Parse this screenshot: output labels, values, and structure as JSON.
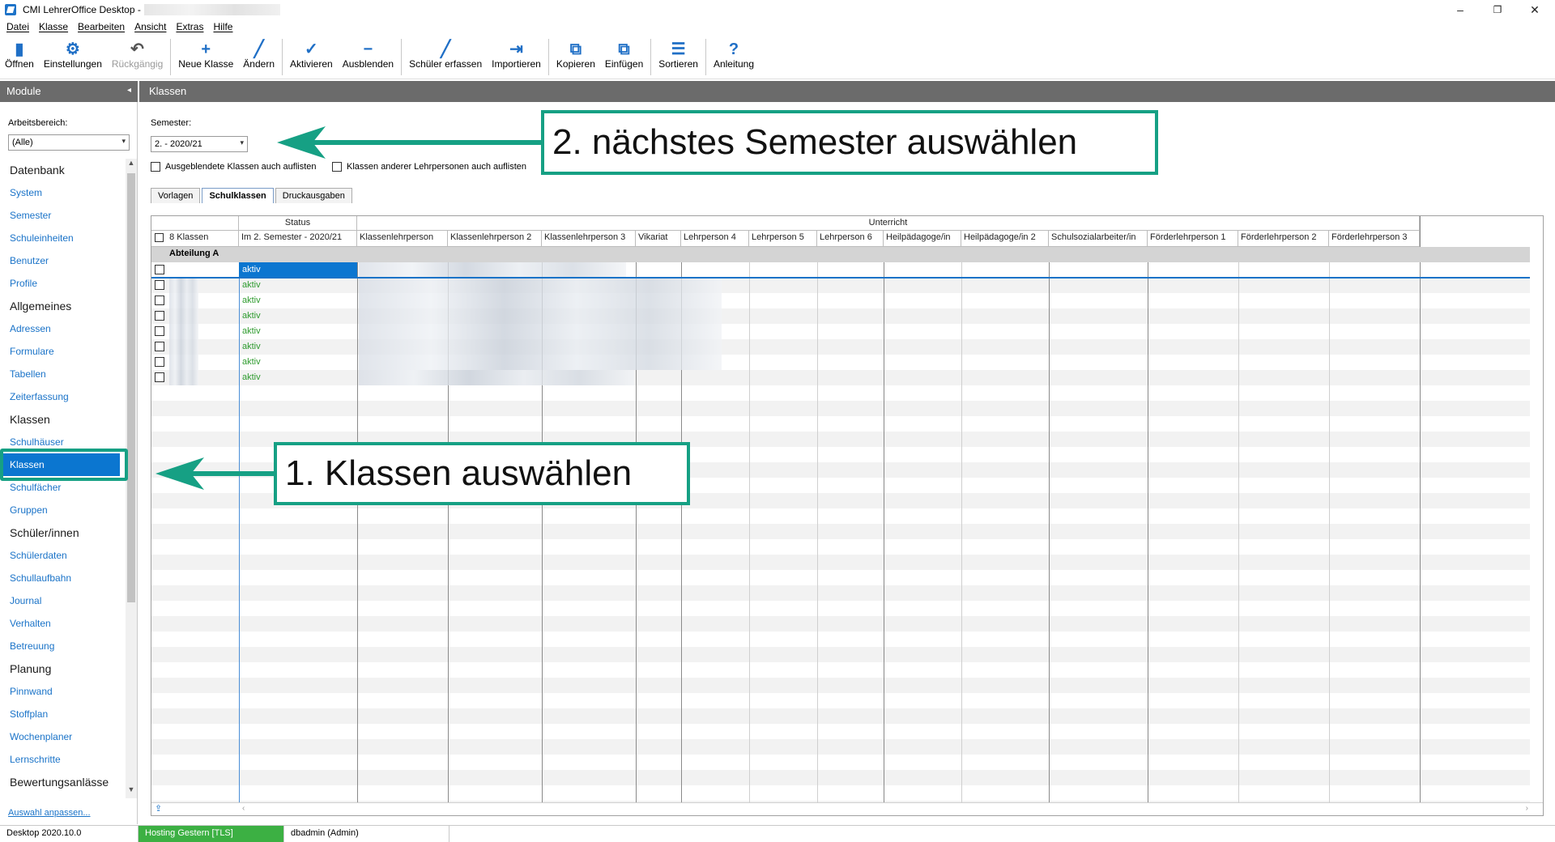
{
  "window": {
    "title": "CMI LehrerOffice Desktop -",
    "minimize_glyph": "–",
    "restore_glyph": "❐",
    "close_glyph": "✕"
  },
  "menu": [
    "Datei",
    "Klasse",
    "Bearbeiten",
    "Ansicht",
    "Extras",
    "Hilfe"
  ],
  "toolbar": {
    "buttons": [
      {
        "label": "Öffnen",
        "icon": "open-book-icon",
        "glyph": "▮"
      },
      {
        "label": "Einstellungen",
        "icon": "gear-icon",
        "glyph": "⚙"
      },
      {
        "label": "Rückgängig",
        "icon": "undo-icon",
        "glyph": "↶",
        "disabled": true
      },
      {
        "label": "Neue Klasse",
        "icon": "plus-icon",
        "glyph": "+"
      },
      {
        "label": "Ändern",
        "icon": "pencil-icon",
        "glyph": "╱"
      },
      {
        "label": "Aktivieren",
        "icon": "check-icon",
        "glyph": "✓"
      },
      {
        "label": "Ausblenden",
        "icon": "minus-icon",
        "glyph": "−"
      },
      {
        "label": "Schüler erfassen",
        "icon": "pencil-icon",
        "glyph": "╱"
      },
      {
        "label": "Importieren",
        "icon": "import-icon",
        "glyph": "⇥"
      },
      {
        "label": "Kopieren",
        "icon": "copy-icon",
        "glyph": "⧉"
      },
      {
        "label": "Einfügen",
        "icon": "paste-icon",
        "glyph": "⧉"
      },
      {
        "label": "Sortieren",
        "icon": "sort-icon",
        "glyph": "☰"
      },
      {
        "label": "Anleitung",
        "icon": "help-icon",
        "glyph": "?"
      }
    ]
  },
  "sidebar": {
    "header": "Module",
    "collapse_glyph": "◂",
    "workspace_label": "Arbeitsbereich:",
    "workspace_value": "(Alle)",
    "groups": [
      {
        "title": "Datenbank",
        "items": [
          "System",
          "Semester",
          "Schuleinheiten",
          "Benutzer",
          "Profile"
        ]
      },
      {
        "title": "Allgemeines",
        "items": [
          "Adressen",
          "Formulare",
          "Tabellen",
          "Zeiterfassung"
        ]
      },
      {
        "title": "Klassen",
        "items": [
          "Schulhäuser",
          "Klassen",
          "Schulfächer",
          "Gruppen"
        ]
      },
      {
        "title": "Schüler/innen",
        "items": [
          "Schülerdaten",
          "Schullaufbahn",
          "Journal",
          "Verhalten",
          "Betreuung"
        ]
      },
      {
        "title": "Planung",
        "items": [
          "Pinnwand",
          "Stoffplan",
          "Wochenplaner",
          "Lernschritte"
        ]
      },
      {
        "title": "Bewertungsanlässe",
        "items": []
      }
    ],
    "selected_item": "Klassen",
    "adjust_link": "Auswahl anpassen..."
  },
  "main": {
    "header": "Klassen",
    "semester_label": "Semester:",
    "semester_value": "2. - 2020/21",
    "option_hidden": "Ausgeblendete Klassen auch auflisten",
    "option_other_teachers": "Klassen anderer Lehrpersonen auch auflisten",
    "tabs": [
      "Vorlagen",
      "Schulklassen",
      "Druckausgaben"
    ],
    "active_tab": "Schulklassen"
  },
  "grid": {
    "group_header_status": "Status",
    "group_header_unterricht": "Unterricht",
    "count_label": "8 Klassen",
    "columns": [
      "Im 2. Semester - 2020/21",
      "Klassenlehrperson",
      "Klassenlehrperson 2",
      "Klassenlehrperson 3",
      "Vikariat",
      "Lehrperson 4",
      "Lehrperson 5",
      "Lehrperson 6",
      "Heilpädagoge/in",
      "Heilpädagoge/in 2",
      "Schulsozialarbeiter/in",
      "Förderlehrperson 1",
      "Förderlehrperson 2",
      "Förderlehrperson 3"
    ],
    "group_row": "Abteilung A",
    "rows": [
      "aktiv",
      "aktiv",
      "aktiv",
      "aktiv",
      "aktiv",
      "aktiv",
      "aktiv",
      "aktiv"
    ]
  },
  "statusbar": {
    "version": "Desktop 2020.10.0",
    "connection": "Hosting Gestern [TLS]",
    "user": "dbadmin (Admin)"
  },
  "annotations": {
    "step1": "1. Klassen auswählen",
    "step2": "2. nächstes Semester auswählen",
    "color": "#16a084"
  },
  "colors": {
    "header_gray": "#6b6b6b",
    "selection_blue": "#0b76d0",
    "link_blue": "#1a73c8",
    "status_green": "#2e9b2e",
    "statusbar_green": "#3cb043"
  }
}
